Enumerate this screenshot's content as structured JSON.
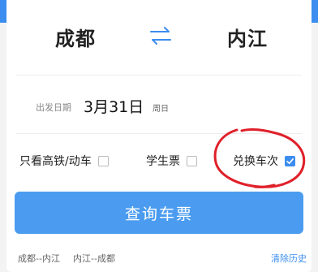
{
  "stations": {
    "from": "成都",
    "to": "内江",
    "swap_icon": "swap-arrows-icon"
  },
  "date": {
    "label": "出发日期",
    "value": "3月31日",
    "weekday": "周日"
  },
  "options": {
    "high_speed_label": "只看高铁/动车",
    "high_speed_checked": false,
    "student_label": "学生票",
    "student_checked": false,
    "exchange_label": "兑换车次",
    "exchange_checked": true
  },
  "query_button": "查询车票",
  "history": {
    "items": [
      "成都--内江",
      "内江--成都"
    ],
    "clear_label": "清除历史"
  },
  "colors": {
    "accent": "#3b8df0",
    "button": "#4b9cf0",
    "annotation": "#e0202a"
  }
}
